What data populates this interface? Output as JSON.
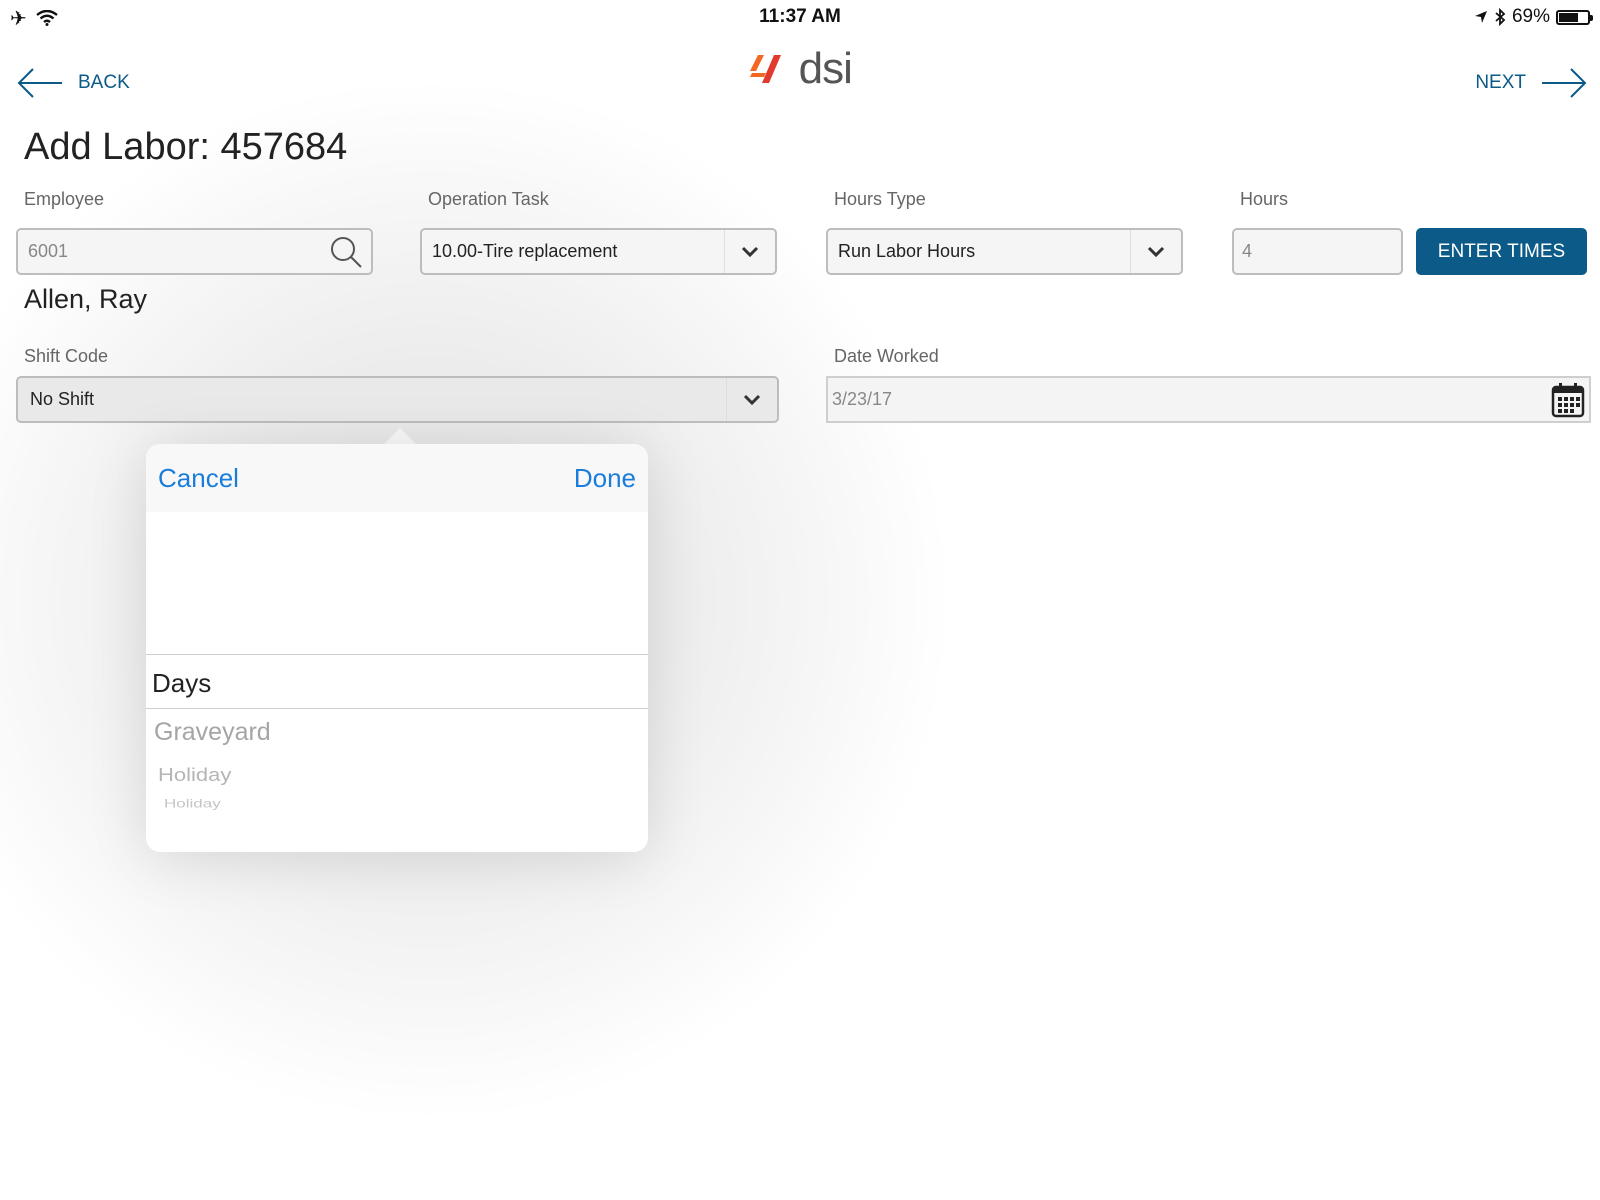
{
  "status_bar": {
    "time": "11:37 AM",
    "battery": "69%",
    "battery_level": 0.69
  },
  "nav": {
    "back_label": "BACK",
    "next_label": "NEXT",
    "logo_text": "dsi"
  },
  "page": {
    "title": "Add Labor: 457684"
  },
  "form": {
    "employee": {
      "label": "Employee",
      "value": "6001",
      "name": "Allen, Ray"
    },
    "operation_task": {
      "label": "Operation Task",
      "value": "10.00-Tire replacement"
    },
    "hours_type": {
      "label": "Hours Type",
      "value": "Run Labor Hours"
    },
    "hours": {
      "label": "Hours",
      "value": "4"
    },
    "enter_times_label": "ENTER TIMES",
    "shift_code": {
      "label": "Shift Code",
      "value": "No Shift"
    },
    "date_worked": {
      "label": "Date Worked",
      "value": "3/23/17"
    }
  },
  "picker": {
    "cancel_label": "Cancel",
    "done_label": "Done",
    "selected": "Days",
    "options_below": [
      "Graveyard",
      "Holiday",
      "Holiday"
    ]
  },
  "colors": {
    "accent": "#0b5a87",
    "ios_blue": "#1a7ddb",
    "logo_orange": "#f26722",
    "logo_red": "#e03a2f",
    "logo_gray": "#555555"
  }
}
